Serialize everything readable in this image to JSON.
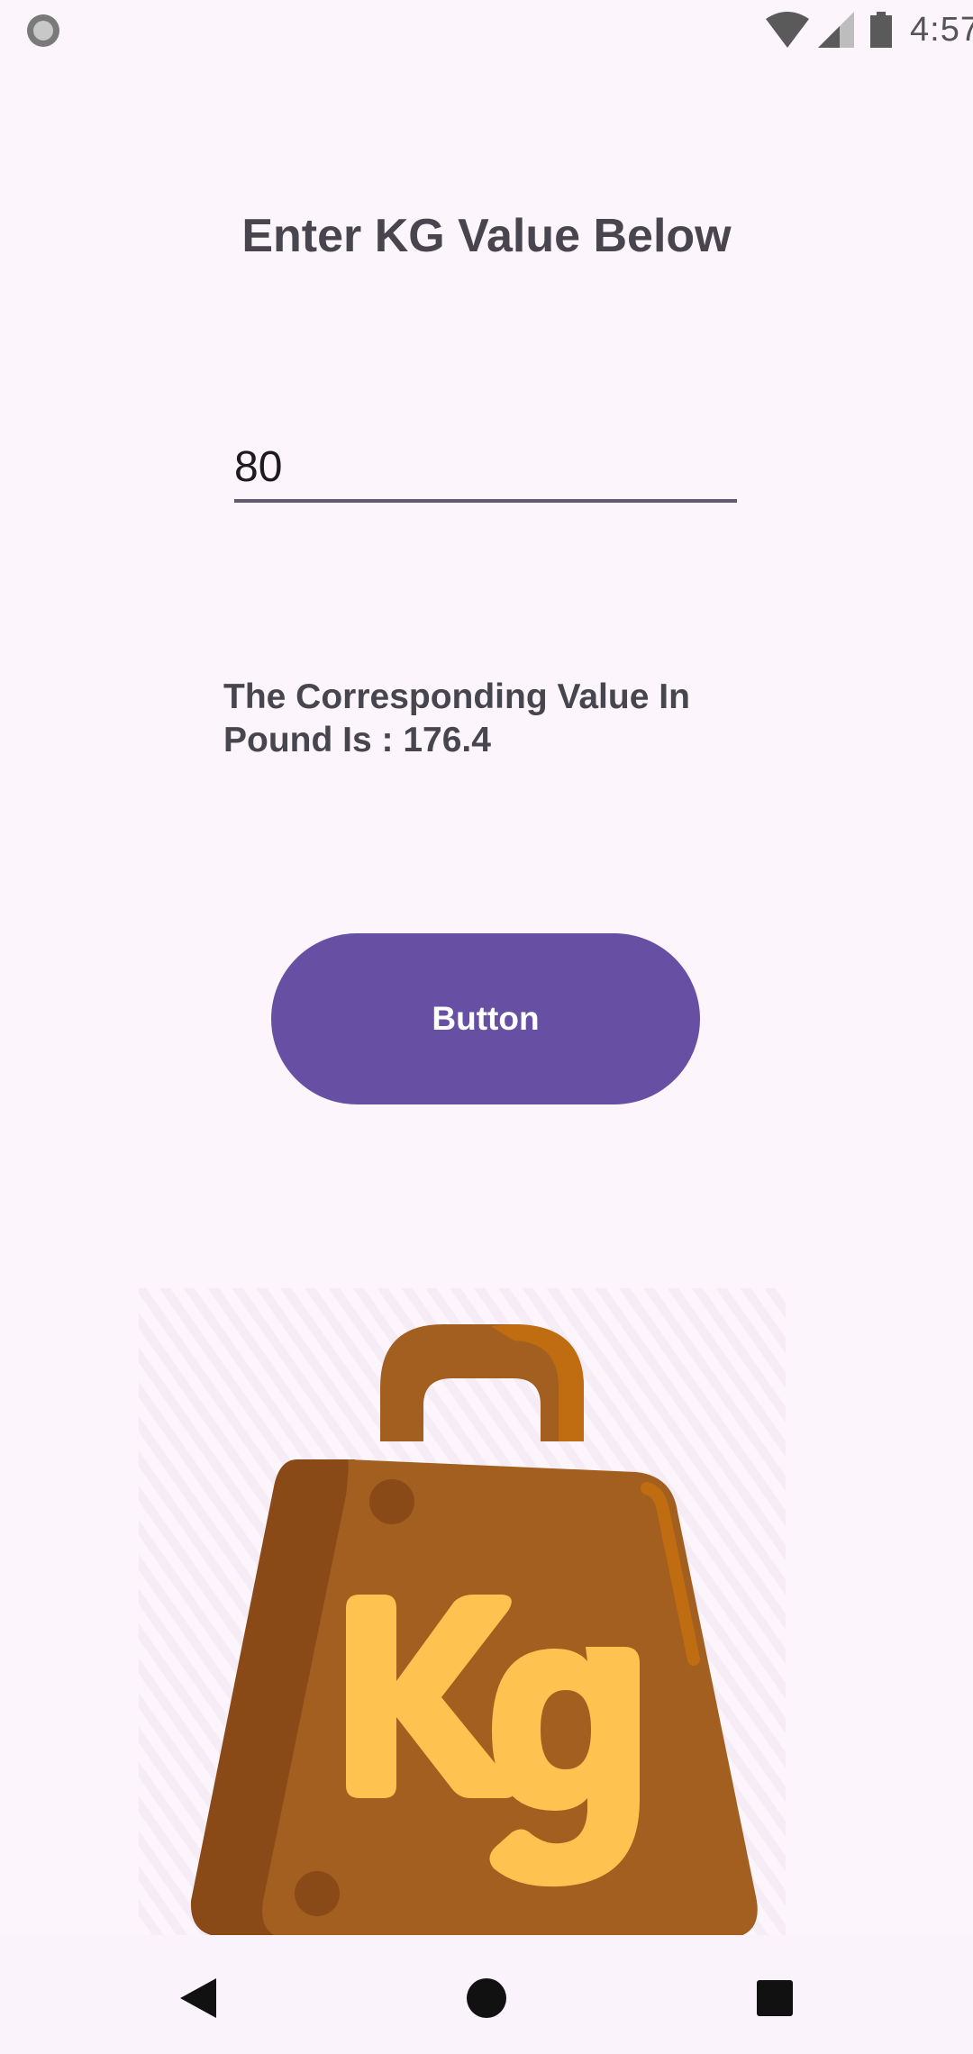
{
  "status_bar": {
    "time": "4:57",
    "icons": [
      "record-icon",
      "wifi-icon",
      "signal-icon",
      "battery-icon"
    ]
  },
  "main": {
    "heading": "Enter KG Value Below",
    "kg_input": {
      "value": "80",
      "placeholder": ""
    },
    "result_text": "The Corresponding Value In Pound Is : 176.4",
    "button_label": "Button",
    "illustration": {
      "label": "Kg",
      "icon": "kg-weight-icon"
    }
  },
  "nav_bar": {
    "icons": [
      "back-icon",
      "home-icon",
      "recents-icon"
    ]
  },
  "colors": {
    "background": "#fcf5fc",
    "accent": "#6750a4",
    "weight_body": "#a35f20",
    "weight_shadow": "#8a4a18",
    "kg_letters": "#fdc24f"
  }
}
